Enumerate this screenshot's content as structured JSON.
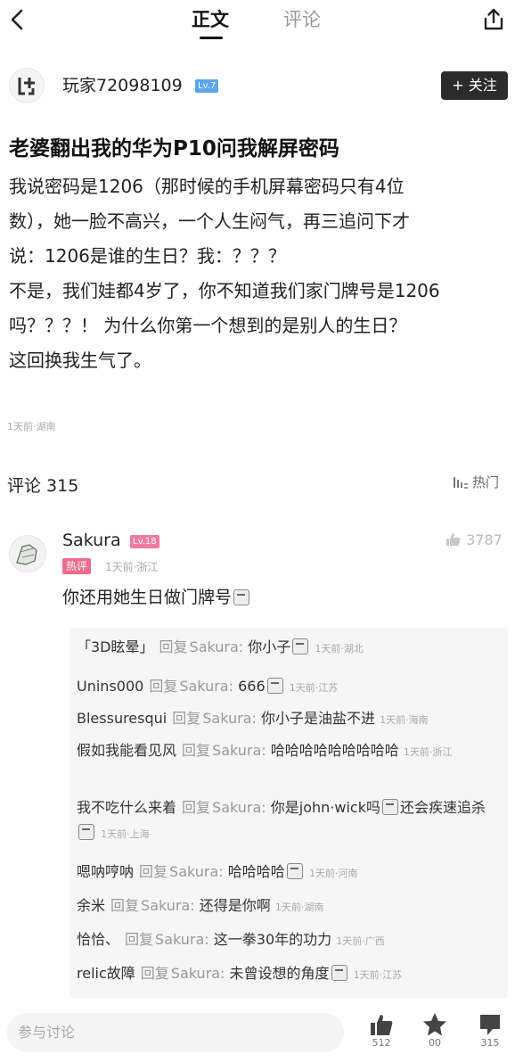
{
  "header": {
    "tab_main": "正文",
    "tab_comments": "评论"
  },
  "author": {
    "name": "玩家72098109",
    "level": "Lv.7",
    "follow_label": "+ 关注"
  },
  "post": {
    "title": "老婆翻出我的华为P10问我解屏密码",
    "body_lines": [
      "我说密码是1206（那时候的手机屏幕密码只有4位",
      "数），她一脸不高兴，一个人生闷气，再三追问下才",
      "说：1206是谁的生日？我：？？？",
      "不是，我们娃都4岁了，你不知道我们家门牌号是1206",
      "吗？？？！ 为什么你第一个想到的是别人的生日？",
      "这回换我生气了。"
    ],
    "meta": "1天前·湖南"
  },
  "comments": {
    "label": "评论",
    "count": "315",
    "sort_label": "热门",
    "top": {
      "name": "Sakura",
      "level": "Lv.18",
      "hot_tag": "热评",
      "meta": "1天前·浙江",
      "text": "你还用她生日做门牌号",
      "likes": "3787"
    },
    "reply_verb": "回复",
    "reply_target": "Sakura:",
    "replies": [
      {
        "name": "「3D眩晕」",
        "text": "你小子",
        "meta": "1天前·湖北"
      },
      {
        "name": "Unins000",
        "text": "666",
        "meta": "1天前·江苏"
      },
      {
        "name": "Blessuresqui",
        "text": "你小子是油盐不进",
        "meta": "1天前·海南"
      },
      {
        "name": "假如我能看见风",
        "text": "哈哈哈哈哈哈哈哈哈",
        "meta": "1天前·浙江"
      },
      {
        "name": "我不吃什么来着",
        "text": "你是john·wick吗",
        "text2": "还会疾速追杀",
        "meta": "1天前·上海"
      },
      {
        "name": "嗯呐哼呐",
        "text": "哈哈哈哈",
        "meta": "1天前·河南"
      },
      {
        "name": "余米",
        "text": "还得是你啊",
        "meta": "1天前·湖南"
      },
      {
        "name": "恰恰、",
        "text": "这一拳30年的功力",
        "meta": "1天前·广西"
      },
      {
        "name": "relic故障",
        "text": "未曾设想的角度",
        "meta": "1天前·江苏"
      }
    ]
  },
  "bottom": {
    "input_placeholder": "参与讨论",
    "like_count": "512",
    "star_count": "00",
    "share_count": "315"
  },
  "colors": {
    "follow_bg": "#2b2b2b",
    "hot_tag": "#ee6b8c",
    "level_blue": "#5aa6ee",
    "level_pink": "#f07aa0"
  },
  "icons": [
    "back-icon",
    "share-icon",
    "sort-icon",
    "like-icon",
    "star-icon",
    "forward-icon"
  ]
}
